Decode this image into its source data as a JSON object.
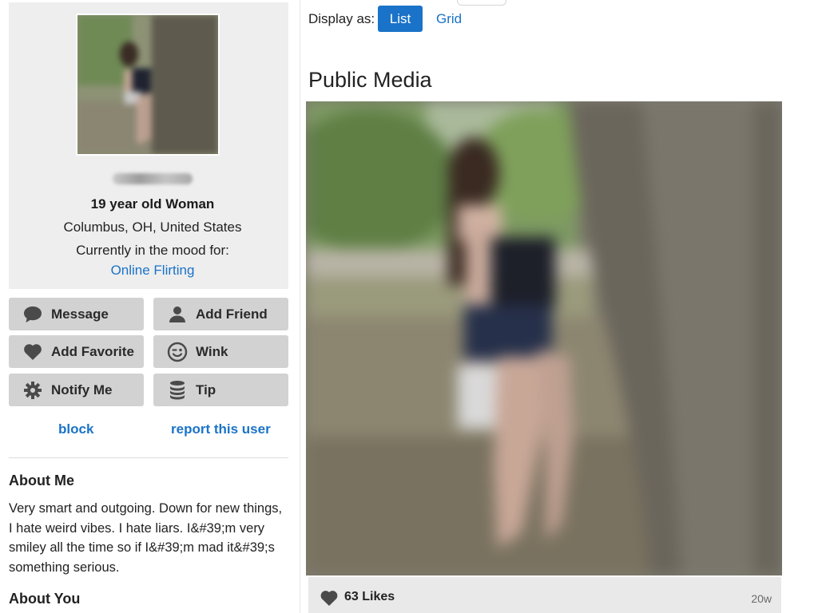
{
  "profile": {
    "age_gender": "19 year old Woman",
    "location": "Columbus, OH, United States",
    "mood_label": "Currently in the mood for:",
    "mood_value": "Online Flirting"
  },
  "actions": {
    "message": "Message",
    "add_friend": "Add Friend",
    "add_favorite": "Add Favorite",
    "wink": "Wink",
    "notify_me": "Notify Me",
    "tip": "Tip",
    "block": "block",
    "report": "report this user"
  },
  "about": {
    "me_heading": "About Me",
    "me_text": "Very smart and outgoing. Down for new things, I hate weird vibes. I hate liars. I&#39;m very smiley all the time so if I&#39;m mad it&#39;s something serious.",
    "you_heading": "About You"
  },
  "display": {
    "label": "Display as:",
    "list": "List",
    "grid": "Grid",
    "selected": "List"
  },
  "media": {
    "title": "Public Media",
    "likes": "63 Likes",
    "age": "20w"
  },
  "colors": {
    "accent": "#1a73c8",
    "button_bg": "#d2d2d2",
    "panel_bg": "#eeeeee"
  },
  "icons": {
    "message": "speech-bubble-icon",
    "add_friend": "person-icon",
    "add_favorite": "heart-icon",
    "wink": "wink-face-icon",
    "notify_me": "gear-icon",
    "tip": "coin-stack-icon",
    "likes": "heart-icon"
  }
}
